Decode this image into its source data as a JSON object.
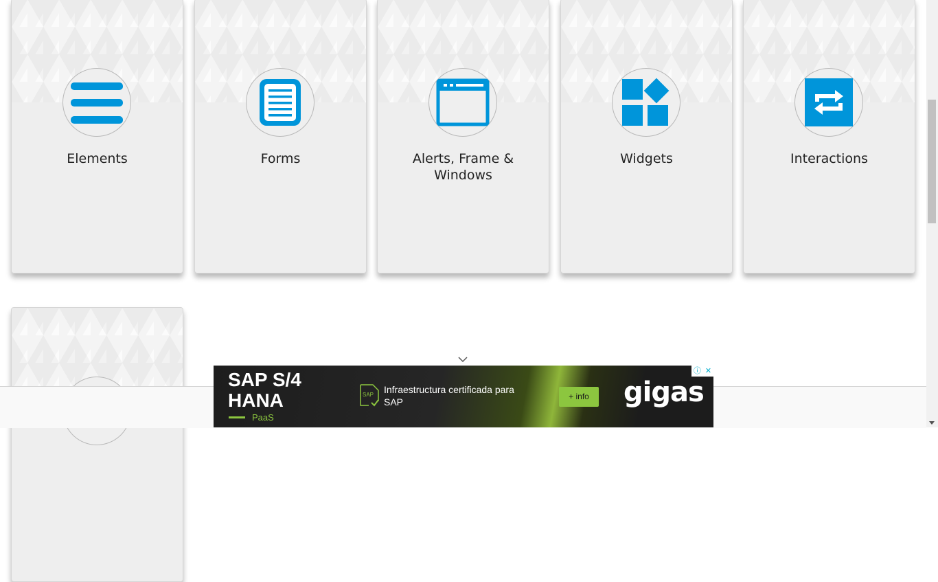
{
  "cards": [
    {
      "title": "Elements",
      "icon": "hamburger-menu-icon"
    },
    {
      "title": "Forms",
      "icon": "document-form-icon"
    },
    {
      "title": "Alerts, Frame & Windows",
      "icon": "browser-window-icon"
    },
    {
      "title": "Widgets",
      "icon": "widgets-blocks-icon"
    },
    {
      "title": "Interactions",
      "icon": "refresh-arrows-icon"
    },
    {
      "title": "",
      "icon": ""
    }
  ],
  "colors": {
    "accent": "#0095da",
    "card_bg": "#eeeeee",
    "ad_green": "#8cc63f"
  },
  "ad": {
    "headline_line1": "SAP S/4",
    "headline_line2": "HANA",
    "sub_label": "PaaS",
    "icon_label": "SAP",
    "tagline": "Infraestructura certificada para SAP",
    "button_label": "+ info",
    "brand": "gigas",
    "info_glyph": "ⓘ",
    "close_glyph": "✕"
  }
}
